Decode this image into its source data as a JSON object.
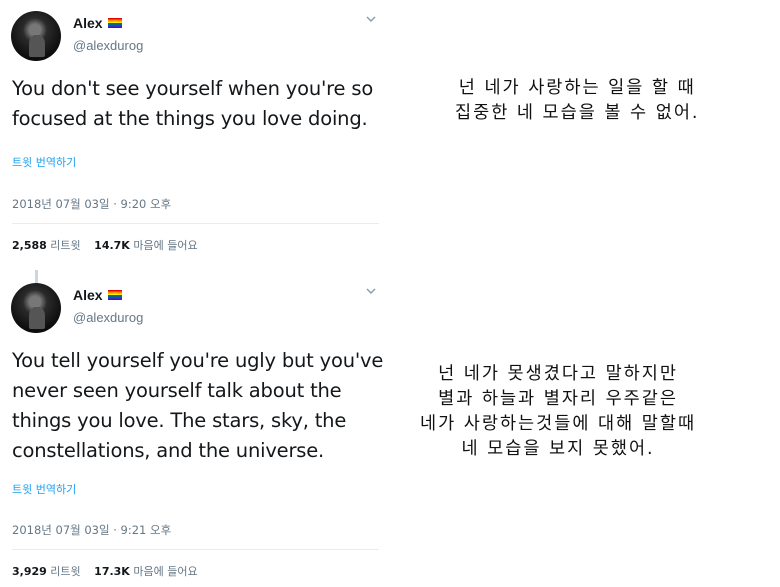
{
  "tweets": [
    {
      "name": "Alex",
      "handle": "@alexdurog",
      "text": "You don't see yourself when you're so focused at the things you love doing.",
      "translate_link": "트윗 번역하기",
      "timestamp": "2018년 07월 03일 · 9:20 오후",
      "retweets": "2,588",
      "retweets_label": "리트윗",
      "likes": "14.7K",
      "likes_label": "마음에 들어요"
    },
    {
      "name": "Alex",
      "handle": "@alexdurog",
      "text": "You tell yourself you're ugly but you've never seen yourself talk about the things you love. The stars, sky, the constellations, and the universe.",
      "translate_link": "트윗 번역하기",
      "timestamp": "2018년 07월 03일 · 9:21 오후",
      "retweets": "3,929",
      "retweets_label": "리트윗",
      "likes": "17.3K",
      "likes_label": "마음에 들어요"
    }
  ],
  "translations": [
    "넌 네가 사랑하는 일을 할 때\n집중한 네 모습을 볼 수 없어.",
    "넌 네가 못생겼다고 말하지만\n별과 하늘과 별자리 우주같은\n네가 사랑하는것들에 대해 말할때\n네 모습을 보지 못했어."
  ],
  "icons": {
    "flag": "rainbow-flag-icon",
    "chevron": "chevron-down-icon",
    "avatar": "profile-avatar"
  },
  "colors": {
    "link": "#1da1f2",
    "secondary_text": "#657786",
    "divider": "#e6ecf0"
  }
}
